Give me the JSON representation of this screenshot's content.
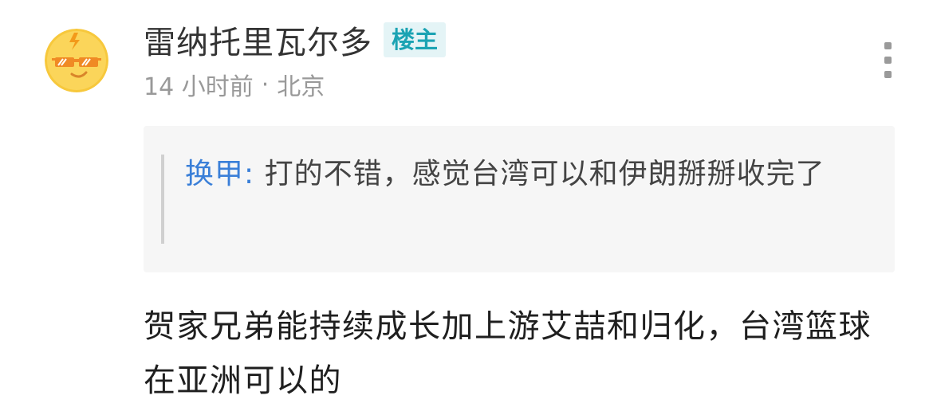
{
  "comment": {
    "username": "雷纳托里瓦尔多",
    "op_badge": "楼主",
    "time": "14 小时前",
    "separator": "·",
    "location": "北京",
    "quote": {
      "author": "换甲",
      "colon": ": ",
      "text": "打的不错，感觉台湾可以和伊朗掰掰收完了"
    },
    "body": "贺家兄弟能持续成长加上游艾喆和归化，台湾篮球在亚洲可以的"
  },
  "colors": {
    "badge_bg": "#e4f4f6",
    "badge_text": "#1ba3b3",
    "quote_author": "#3a7fd8",
    "avatar_bg": "#f7c83c"
  },
  "icons": {
    "avatar": "sunglasses-lightning-face",
    "more": "more-vertical-icon"
  }
}
